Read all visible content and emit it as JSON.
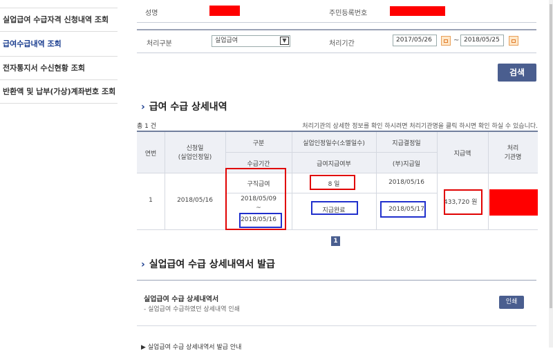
{
  "sidebar": {
    "items": [
      {
        "label": "실업급여 수급자격 신청내역 조회",
        "active": false
      },
      {
        "label": "급여수급내역 조회",
        "active": true
      },
      {
        "label": "전자통지서 수신현황 조회",
        "active": false
      },
      {
        "label": "반환액 및 납부(가상)계좌번호 조회",
        "active": false
      }
    ]
  },
  "person": {
    "name_label": "성명",
    "rrn_label": "주민등록번호"
  },
  "filter": {
    "type_label": "처리구분",
    "type_value": "실업급여",
    "period_label": "처리기간",
    "start_date": "2017/05/26",
    "tilde": "~",
    "end_date": "2018/05/25",
    "search_label": "검색"
  },
  "detail": {
    "title": "급여 수급 상세내역",
    "total": "총 1 건",
    "notice": "처리기관의 상세한 정보를 확인 하시려면 처리기관명을 클릭 하시면 확인 하실 수 있습니다.",
    "headers": {
      "no": "연번",
      "apply_date": "신청일",
      "apply_date_sub": "(실업인정일)",
      "category": "구분",
      "period": "수급기간",
      "days": "실업인정일수(소멸일수)",
      "paid_status": "급여지급여부",
      "decision_date": "지급결정일",
      "paid_date": "(부)지급일",
      "amount": "지급액",
      "agency": "처리",
      "agency_sub": "기관명"
    },
    "row": {
      "no": "1",
      "apply_date": "2018/05/16",
      "category": "구직급여",
      "period_start": "2018/05/09",
      "period_tilde": "~",
      "period_end": "2018/05/16",
      "days": "8 일",
      "paid_status": "지급완료",
      "decision_date": "2018/05/16",
      "paid_date": "2018/05/17",
      "amount": "433,720 원"
    },
    "page": "1"
  },
  "issue": {
    "title": "실업급여 수급 상세내역서 발급",
    "doc_title": "실업급여 수급 상세내역서",
    "doc_desc": "- 실업급여 수급하였던 상세내역 인쇄",
    "print_label": "인쇄",
    "footer_text": "▶ 실업급여 수급 상세내역서 발급 안내"
  }
}
